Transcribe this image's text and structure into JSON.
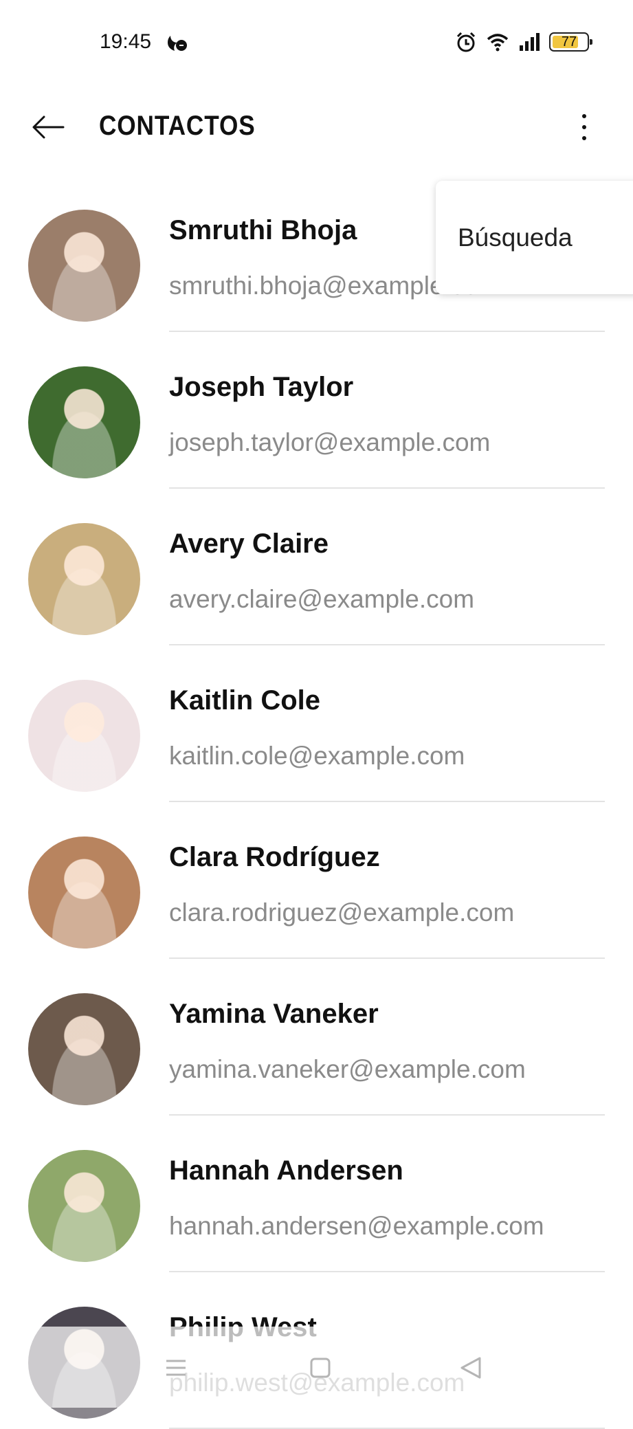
{
  "status_bar": {
    "time": "19:45",
    "battery": "77",
    "icons": [
      "dnd-icon",
      "alarm-icon",
      "wifi-icon",
      "signal-icon",
      "battery-icon"
    ]
  },
  "app_bar": {
    "title": "CONTACTOS",
    "back_icon": "arrow-left-icon",
    "more_icon": "more-vertical-icon"
  },
  "overflow_menu": {
    "items": [
      {
        "label": "Búsqueda"
      }
    ]
  },
  "contacts": [
    {
      "name": "Smruthi Bhoja",
      "email": "smruthi.bhoja@example.com",
      "avatar_color": "#9b7e6a"
    },
    {
      "name": "Joseph Taylor",
      "email": "joseph.taylor@example.com",
      "avatar_color": "#3f6b2f"
    },
    {
      "name": "Avery Claire",
      "email": "avery.claire@example.com",
      "avatar_color": "#c9ae7d"
    },
    {
      "name": "Kaitlin Cole",
      "email": "kaitlin.cole@example.com",
      "avatar_color": "#efe2e4"
    },
    {
      "name": "Clara Rodríguez",
      "email": "clara.rodriguez@example.com",
      "avatar_color": "#b8845f"
    },
    {
      "name": "Yamina Vaneker",
      "email": "yamina.vaneker@example.com",
      "avatar_color": "#6d5a4c"
    },
    {
      "name": "Hannah Andersen",
      "email": "hannah.andersen@example.com",
      "avatar_color": "#8fa86a"
    },
    {
      "name": "Philip West",
      "email": "philip.west@example.com",
      "avatar_color": "#4b4650"
    }
  ],
  "nav_bar": {
    "icons": [
      "menu-icon",
      "home-square-icon",
      "back-triangle-icon"
    ]
  }
}
